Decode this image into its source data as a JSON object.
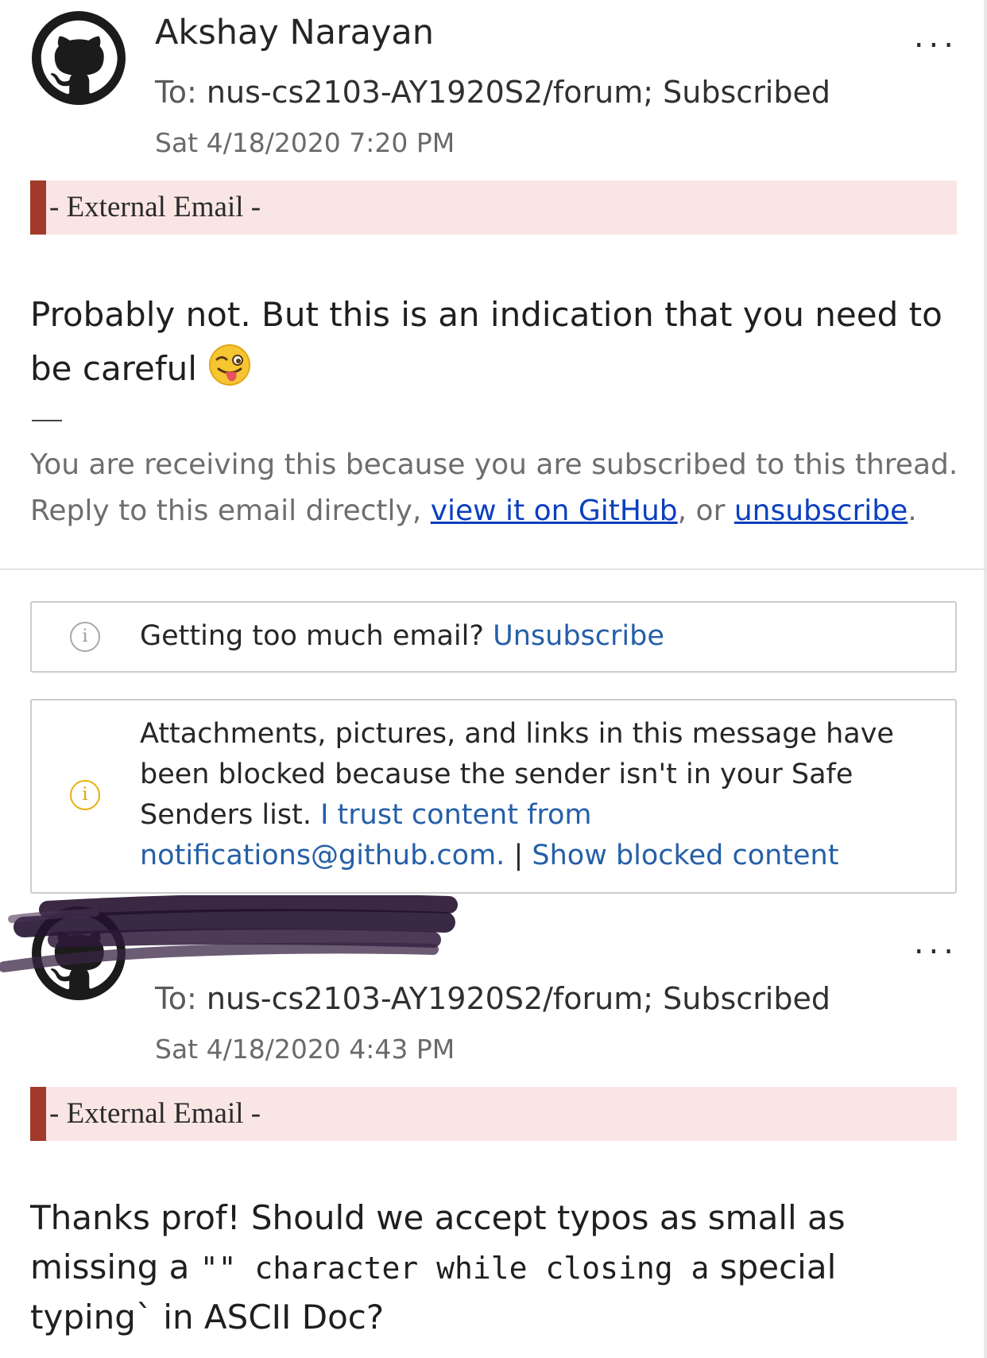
{
  "message1": {
    "sender": "Akshay Narayan",
    "to_prefix": "To:",
    "to": "nus-cs2103-AY1920S2/forum;",
    "label": "Subscribed",
    "date": "Sat 4/18/2020 7:20 PM",
    "more": "...",
    "external_banner": "- External Email -",
    "body": "Probably not. But this is an indication that you need to be careful",
    "body_emoji": "winking-tongue-face",
    "footer_dash": "—",
    "footer_line1": "You are receiving this because you are subscribed to this thread.",
    "footer_line2_prefix": "Reply to this email directly,",
    "footer_link_view": "view it on GitHub",
    "footer_mid": ", or",
    "footer_link_unsub": "unsubscribe",
    "footer_end": "."
  },
  "notice_unsub": {
    "text": "Getting too much email?",
    "link": "Unsubscribe"
  },
  "notice_blocked": {
    "text": "Attachments, pictures, and links in this message have been blocked because the sender isn't in your Safe Senders list.",
    "link_trust": "I trust content from notifications@github.com.",
    "separator": "|",
    "link_show": "Show blocked content"
  },
  "message2": {
    "sender": "",
    "to_prefix": "To:",
    "to": "nus-cs2103-AY1920S2/forum;",
    "label": "Subscribed",
    "date": "Sat 4/18/2020 4:43 PM",
    "more": "...",
    "external_banner": "- External Email -",
    "body_part1": "Thanks prof! Should we accept typos as small as missing a",
    "body_mono": "\"\" character while closing a",
    "body_part2": "special typing` in ASCII Doc?"
  },
  "colors": {
    "link_blue": "#0b3fbf",
    "action_blue": "#255fa8",
    "banner_bg": "#fae5e5",
    "banner_bar": "#a13a2a"
  }
}
